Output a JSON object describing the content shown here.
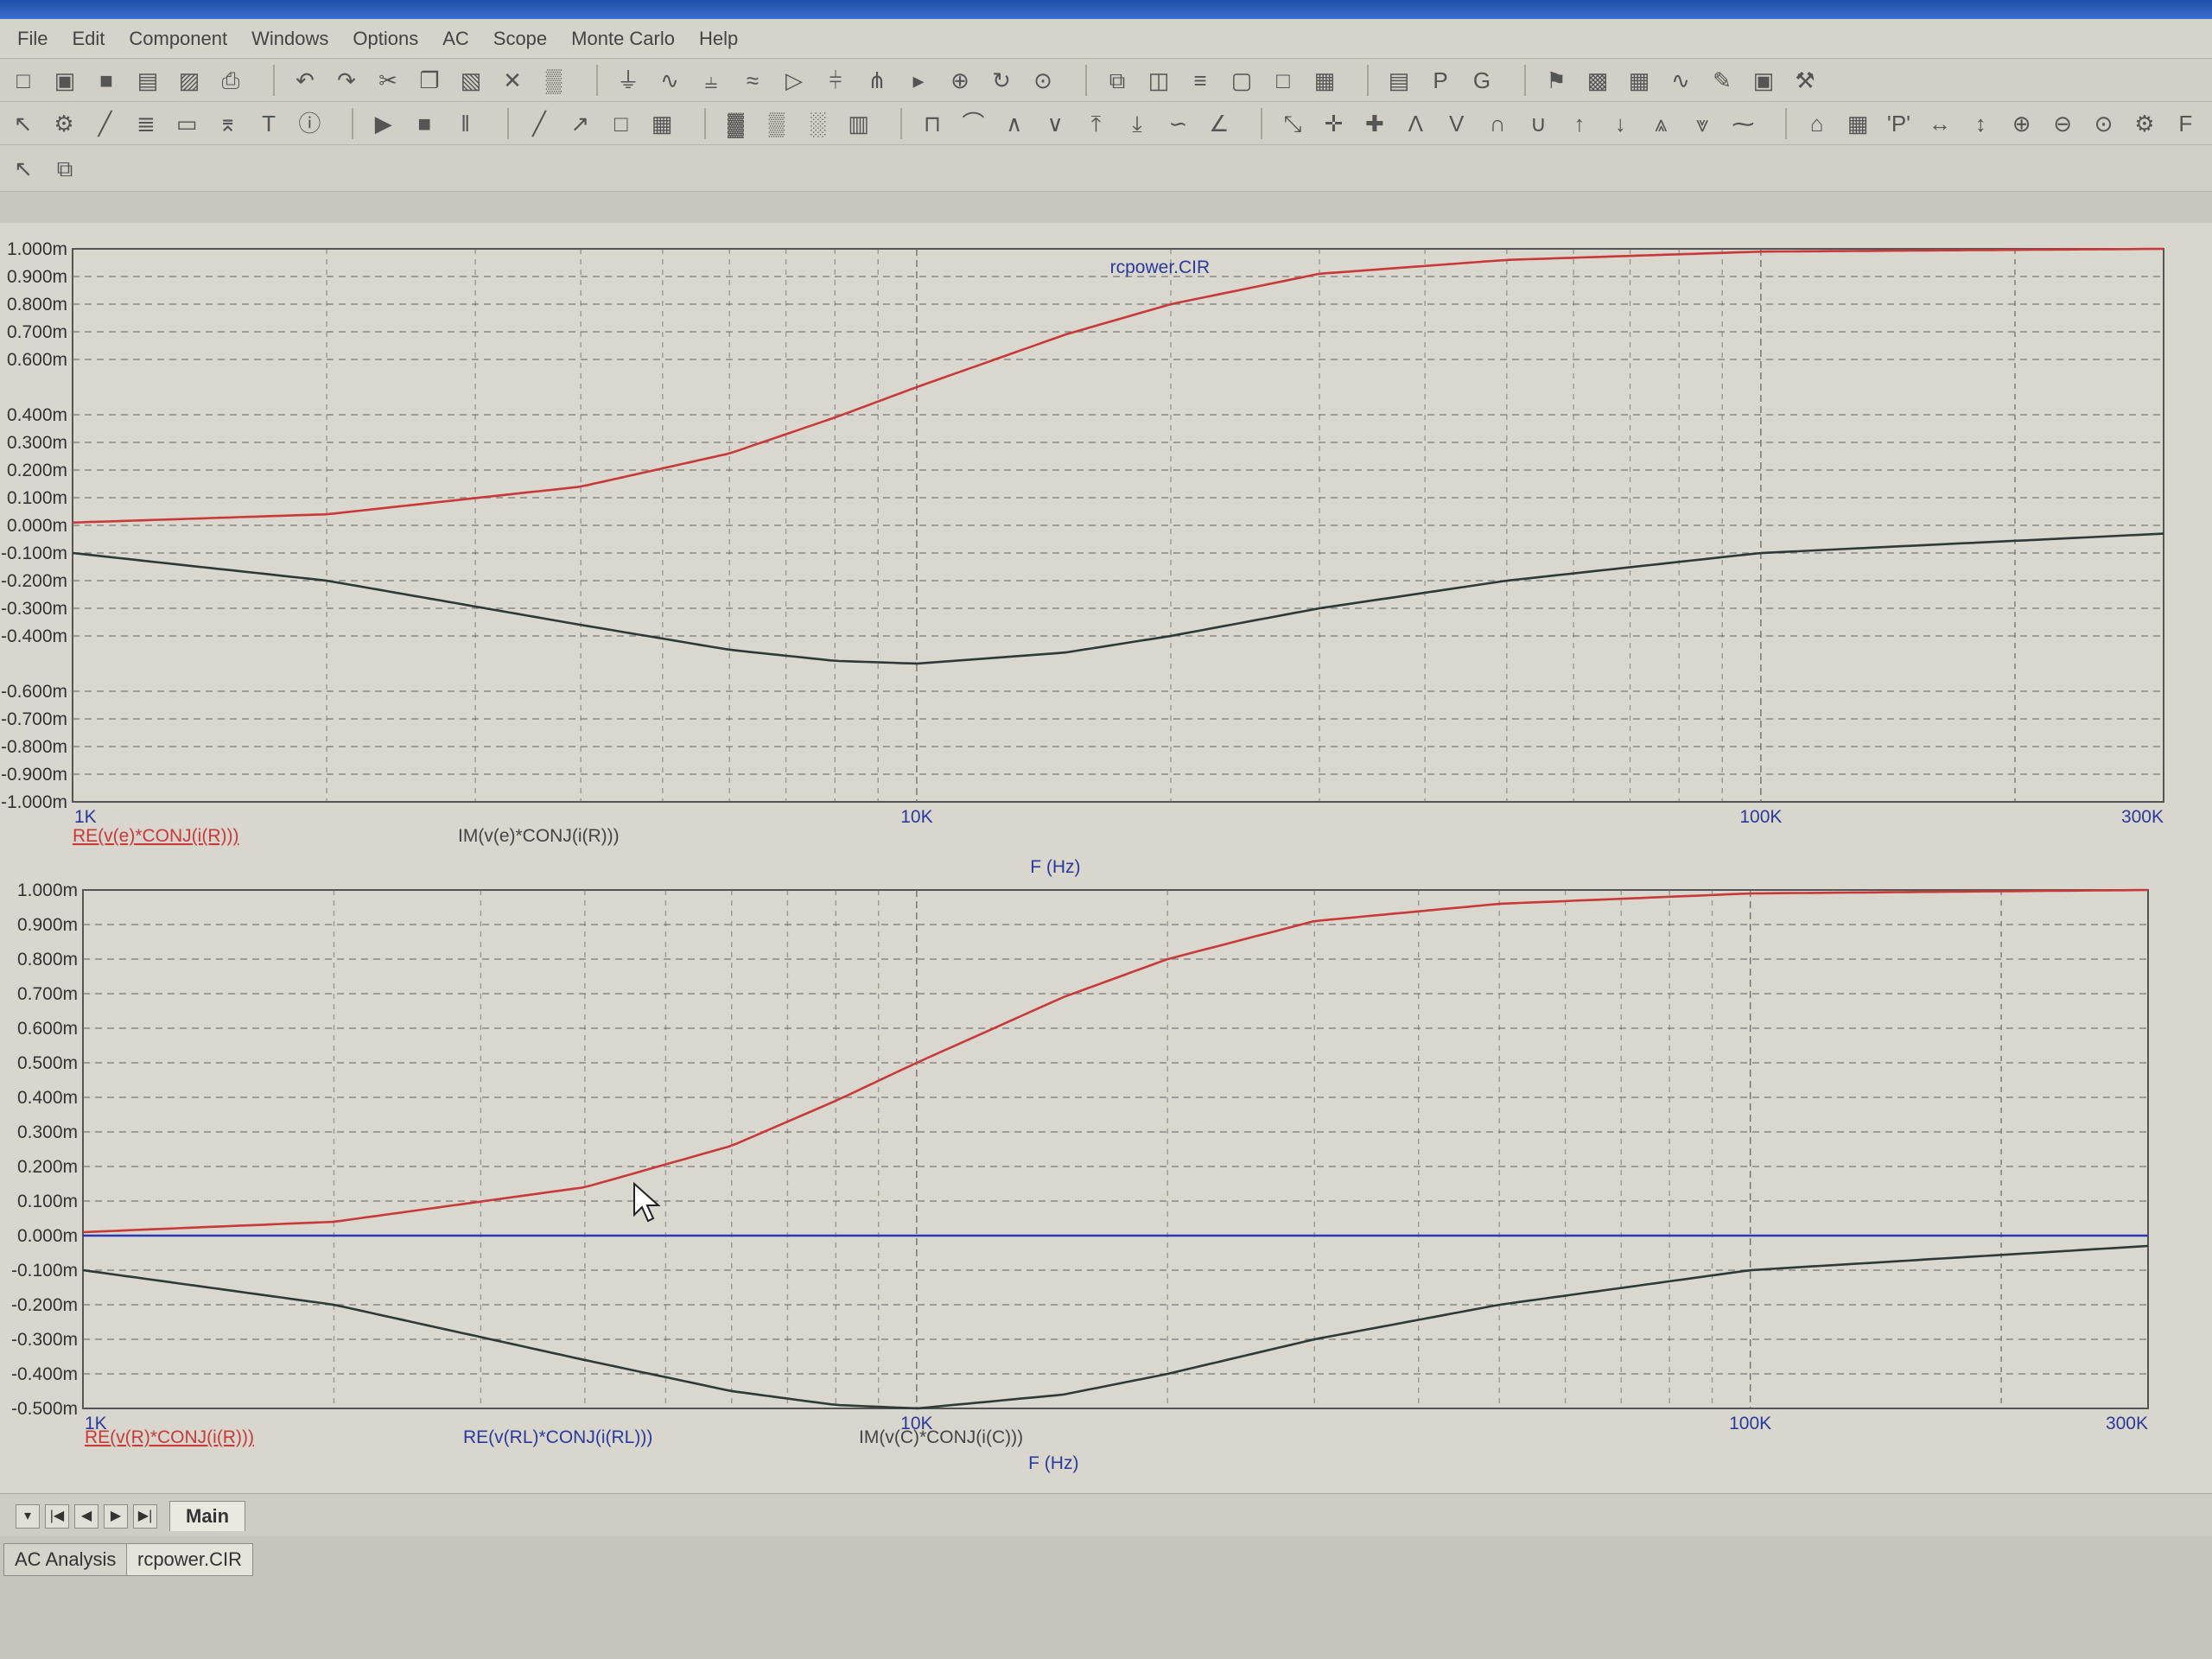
{
  "menu": [
    "File",
    "Edit",
    "Component",
    "Windows",
    "Options",
    "AC",
    "Scope",
    "Monte Carlo",
    "Help"
  ],
  "toolbars": {
    "row1": [
      "new-icon",
      "open-icon",
      "save-icon",
      "save-all-icon",
      "print-preview-icon",
      "print-icon",
      "|",
      "undo-icon",
      "redo-icon",
      "cut-icon",
      "copy-icon",
      "paste-icon",
      "delete-icon",
      "select-all-icon",
      "|",
      "ground-icon",
      "resistor-icon",
      "capacitor-icon",
      "inductor-icon",
      "diode-icon",
      "battery-icon",
      "npn-icon",
      "opamp-icon",
      "voltage-source-icon",
      "current-source-icon",
      "ammeter-icon",
      "|",
      "cascade-icon",
      "tile-vertical-icon",
      "tile-horizontal-icon",
      "window-icon",
      "maximize-icon",
      "calculator-icon",
      "|",
      "properties-icon",
      "p-icon",
      "g-icon",
      "|",
      "probe-icon",
      "analysis-icon",
      "table-icon",
      "waveform-icon",
      "pen-icon",
      "bitmap-icon",
      "tools-icon"
    ],
    "row2": [
      "select-icon",
      "component-icon",
      "wire-icon",
      "bus-icon",
      "text-icon",
      "graph-icon",
      "text-t-icon",
      "info-icon",
      "|",
      "run-icon",
      "stop-icon",
      "pause-icon",
      "|",
      "line-icon",
      "diagonal-icon",
      "rectangle-icon",
      "grid-icon",
      "|",
      "grid-fine-icon",
      "grid-medium-icon",
      "grid-coarse-icon",
      "minor-grid-icon",
      "|",
      "cursor-mode-icon",
      "tracker-icon",
      "peak-icon",
      "valley-icon",
      "high-icon",
      "low-icon",
      "inflection-icon",
      "slope-icon",
      "|",
      "scale-icon",
      "cursor-x-icon",
      "cursor-y-icon",
      "peak-marker-icon",
      "valley-marker-icon",
      "rise-icon",
      "fall-icon",
      "up-icon",
      "down-icon",
      "global-high-icon",
      "global-low-icon",
      "inflect-icon",
      "|",
      "tag-icon",
      "table-format-icon",
      "p-quote-icon",
      "x-scale-icon",
      "y-scale-icon",
      "zoom-in-icon",
      "zoom-out-icon",
      "zoom-icon",
      "settings-icon",
      "f-icon"
    ],
    "row3": [
      "select-arrow-icon",
      "copy-graph-icon"
    ]
  },
  "colors": {
    "red_trace": "#c83a3a",
    "dark_trace": "#2e3a36",
    "blue_trace": "#2838b8",
    "label_blue": "#2a3a9c",
    "axis_text": "#333333",
    "plot_bg": "#dad7cf"
  },
  "plot1": {
    "title": "rcpower.CIR",
    "y_ticks": [
      "1.000m",
      "0.900m",
      "0.800m",
      "0.700m",
      "0.600m",
      "0.400m",
      "0.300m",
      "0.200m",
      "0.100m",
      "0.000m",
      "-0.100m",
      "-0.200m",
      "-0.300m",
      "-0.400m",
      "-0.600m",
      "-0.700m",
      "-0.800m",
      "-0.900m",
      "-1.000m"
    ],
    "x_ticks": [
      "1K",
      "10K",
      "100K",
      "300K"
    ],
    "x_label": "F (Hz)",
    "legend": [
      "RE(v(e)*CONJ(i(R)))",
      "IM(v(e)*CONJ(i(R)))"
    ]
  },
  "plot2": {
    "y_ticks": [
      "1.000m",
      "0.900m",
      "0.800m",
      "0.700m",
      "0.600m",
      "0.500m",
      "0.400m",
      "0.300m",
      "0.200m",
      "0.100m",
      "0.000m",
      "-0.100m",
      "-0.200m",
      "-0.300m",
      "-0.400m",
      "-0.500m"
    ],
    "x_ticks": [
      "1K",
      "10K",
      "100K",
      "300K"
    ],
    "x_label": "F (Hz)",
    "legend": [
      "RE(v(R)*CONJ(i(R)))",
      "RE(v(RL)*CONJ(i(RL)))",
      "IM(v(C)*CONJ(i(C)))"
    ]
  },
  "chart_data": [
    {
      "type": "line",
      "title": "rcpower.CIR",
      "xlabel": "F (Hz)",
      "ylabel": "",
      "x_scale": "log",
      "xlim": [
        1000,
        300000
      ],
      "ylim": [
        -0.001,
        0.001
      ],
      "grid": true,
      "x": [
        1000,
        2000,
        4000,
        6000,
        8000,
        10000,
        15000,
        20000,
        30000,
        50000,
        100000,
        300000
      ],
      "series": [
        {
          "name": "RE(v(e)*CONJ(i(R)))",
          "values": [
            1e-05,
            4e-05,
            0.00014,
            0.00026,
            0.00039,
            0.0005,
            0.00069,
            0.0008,
            0.00091,
            0.00096,
            0.00099,
            0.001
          ]
        },
        {
          "name": "IM(v(e)*CONJ(i(R)))",
          "values": [
            -0.0001,
            -0.0002,
            -0.00036,
            -0.00045,
            -0.00049,
            -0.0005,
            -0.00046,
            -0.0004,
            -0.0003,
            -0.0002,
            -0.0001,
            -3e-05
          ]
        }
      ]
    },
    {
      "type": "line",
      "xlabel": "F (Hz)",
      "ylabel": "",
      "x_scale": "log",
      "xlim": [
        1000,
        300000
      ],
      "ylim": [
        -0.0005,
        0.001
      ],
      "grid": true,
      "x": [
        1000,
        2000,
        4000,
        6000,
        8000,
        10000,
        15000,
        20000,
        30000,
        50000,
        100000,
        300000
      ],
      "series": [
        {
          "name": "RE(v(R)*CONJ(i(R)))",
          "values": [
            1e-05,
            4e-05,
            0.00014,
            0.00026,
            0.00039,
            0.0005,
            0.00069,
            0.0008,
            0.00091,
            0.00096,
            0.00099,
            0.001
          ]
        },
        {
          "name": "RE(v(RL)*CONJ(i(RL)))",
          "values": [
            0,
            0,
            0,
            0,
            0,
            0,
            0,
            0,
            0,
            0,
            0,
            0
          ]
        },
        {
          "name": "IM(v(C)*CONJ(i(C)))",
          "values": [
            -0.0001,
            -0.0002,
            -0.00036,
            -0.00045,
            -0.00049,
            -0.0005,
            -0.00046,
            -0.0004,
            -0.0003,
            -0.0002,
            -0.0001,
            -3e-05
          ]
        }
      ]
    }
  ],
  "tabs": {
    "sheet": "Main",
    "docs": [
      "AC Analysis",
      "rcpower.CIR"
    ]
  }
}
